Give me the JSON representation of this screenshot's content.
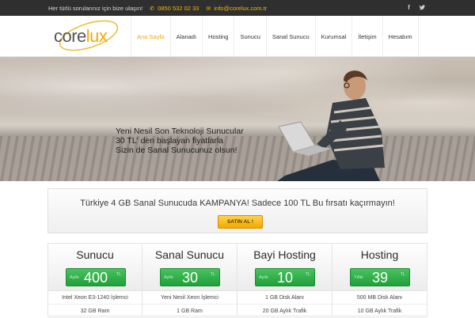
{
  "topbar": {
    "contact_text": "Her türlü sorularınız için bize ulaşın!",
    "phone": "0850 532 02 33",
    "email": "info@corelux.com.tr",
    "phone_icon": "phone-icon",
    "email_icon": "envelope-icon",
    "social": [
      "facebook-icon",
      "twitter-icon"
    ]
  },
  "header": {
    "logo_text": "corelux",
    "nav": [
      "Ana Sayfa",
      "Alanadı",
      "Hosting",
      "Sunucu",
      "Sanal Sunucu",
      "Kurumsal",
      "İletişim",
      "Hesabım"
    ],
    "active_index": 0
  },
  "hero": {
    "line1": "Yeni Nesil Son Teknoloji Sunucular",
    "line2": "30 TL' den başlayan fiyatlarla",
    "line3": "Sizin de Sanal Sunucunuz olsun!"
  },
  "campaign": {
    "message": "Türkiye 4 GB Sanal Sunucuda KAMPANYA! Sadece 100 TL Bu fırsatı kaçırmayın!",
    "button": "SATIN AL !"
  },
  "plans": [
    {
      "name": "Sunucu",
      "per": "Aylık",
      "price": "400",
      "currency": "TL",
      "features": [
        "Intel Xeon E3-1240 İşlemci",
        "32 GB Ram"
      ]
    },
    {
      "name": "Sanal Sunucu",
      "per": "Aylık",
      "price": "30",
      "currency": "TL",
      "features": [
        "Yeni Nesil Xeon İşlemci",
        "1 GB Ram"
      ]
    },
    {
      "name": "Bayi Hosting",
      "per": "Aylık",
      "price": "10",
      "currency": "TL",
      "features": [
        "1 GB Disk Alanı",
        "20 GB Aylık Trafik"
      ]
    },
    {
      "name": "Hosting",
      "per": "Yıllık",
      "price": "39",
      "currency": "TL",
      "features": [
        "500 MB Disk Alanı",
        "10 GB Aylık Trafik"
      ]
    }
  ],
  "colors": {
    "accent": "#f2a900",
    "green": "#21a03a",
    "topbar": "#2f2f2f"
  }
}
